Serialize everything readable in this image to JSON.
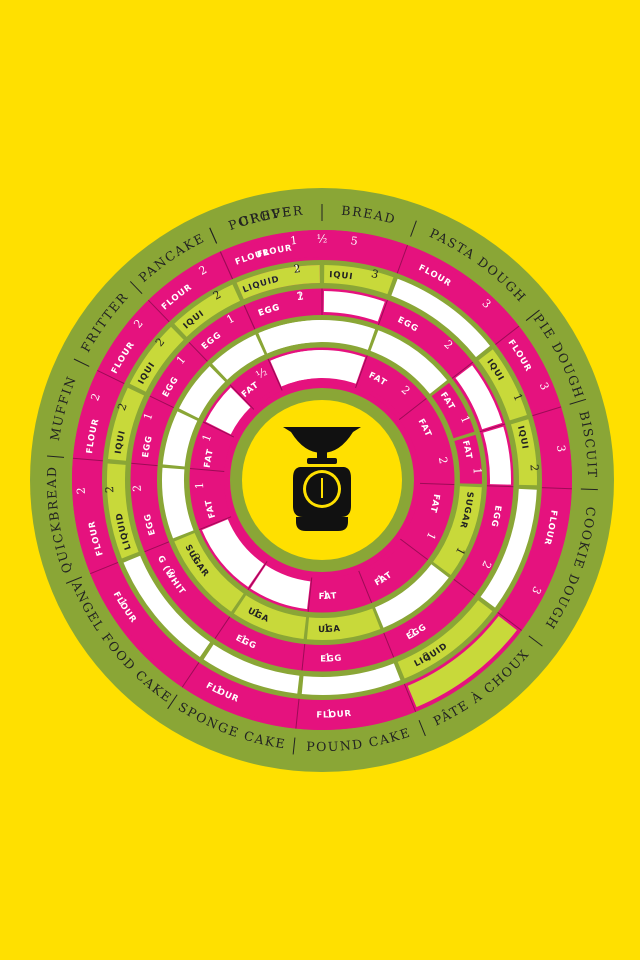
{
  "colors": {
    "background": "#FFE000",
    "olive": "#8AA636",
    "magenta": "#E5127E",
    "lime": "#C8D93A",
    "white": "#FFFFFF",
    "text_dark": "#222222",
    "text_light": "#FFFFFF",
    "scale_icon": "#111111"
  },
  "recipe_order": [
    "Muffin",
    "Fritter",
    "Pancake",
    "Popover",
    "Crepe",
    "Bread",
    "Pasta Dough",
    "Pie Dough",
    "Biscuit",
    "Cookie Dough",
    "Pâte à Choux",
    "Pound Cake",
    "Sponge Cake",
    "Angel Food Cake",
    "Quickbread"
  ],
  "outer_ring": {
    "separator": "|",
    "recipes": [
      {
        "name": "CREPE",
        "start": -24,
        "end": 0
      },
      {
        "name": "BREAD",
        "start": 0,
        "end": 20
      },
      {
        "name": "PASTA DOUGH",
        "start": 20,
        "end": 52
      },
      {
        "name": "PIE DOUGH",
        "start": 52,
        "end": 73
      },
      {
        "name": "BISCUIT",
        "start": 73,
        "end": 92
      },
      {
        "name": "COOKIE DOUGH",
        "start": 92,
        "end": 127
      },
      {
        "name": "PÂTE À CHOUX",
        "start": 127,
        "end": 158
      },
      {
        "name": "POUND CAKE",
        "start": 158,
        "end": 186
      },
      {
        "name": "SPONGE CAKE",
        "start": 186,
        "end": 214
      },
      {
        "name": "ANGEL FOOD CAKE",
        "start": 214,
        "end": 248
      },
      {
        "name": "QUICKBREAD",
        "start": 248,
        "end": 275
      },
      {
        "name": "MUFFIN",
        "start": 275,
        "end": 296
      },
      {
        "name": "FRITTER",
        "start": 296,
        "end": 316
      },
      {
        "name": "PANCAKE",
        "start": 316,
        "end": 336
      },
      {
        "name": "POPOVER",
        "start": 336,
        "end": 360
      }
    ]
  },
  "rings": [
    {
      "name": "ring-1",
      "segments": [
        {
          "ingredient": "FLOUR",
          "qty": "5",
          "start": -24,
          "end": 20,
          "color": "magenta"
        },
        {
          "ingredient": "FLOUR",
          "qty": "3",
          "start": 20,
          "end": 52,
          "color": "magenta"
        },
        {
          "ingredient": "FLOUR",
          "qty": "3",
          "start": 52,
          "end": 73,
          "color": "magenta"
        },
        {
          "ingredient": "",
          "qty": "3",
          "start": 73,
          "end": 92,
          "color": "magenta"
        },
        {
          "ingredient": "FLOUR",
          "qty": "3",
          "start": 92,
          "end": 127,
          "color": "magenta"
        },
        {
          "ingredient": "",
          "qty": "",
          "start": 127,
          "end": 158,
          "color": "lime"
        },
        {
          "ingredient": "FLOUR",
          "qty": "1",
          "start": 158,
          "end": 186,
          "color": "magenta"
        },
        {
          "ingredient": "FLOUR",
          "qty": "1",
          "start": 186,
          "end": 214,
          "color": "magenta"
        },
        {
          "ingredient": "FLOUR",
          "qty": "1",
          "start": 214,
          "end": 248,
          "color": "magenta"
        },
        {
          "ingredient": "FLOUR",
          "qty": "2",
          "start": 248,
          "end": 275,
          "color": "magenta"
        },
        {
          "ingredient": "FLOUR",
          "qty": "2",
          "start": 275,
          "end": 296,
          "color": "magenta"
        },
        {
          "ingredient": "FLOUR",
          "qty": "2",
          "start": 296,
          "end": 316,
          "color": "magenta"
        },
        {
          "ingredient": "FLOUR",
          "qty": "2",
          "start": 316,
          "end": 336,
          "color": "magenta"
        },
        {
          "ingredient": "FLOUR",
          "qty": "1",
          "start": 336,
          "end": 360,
          "color": "magenta"
        },
        {
          "ingredient": "",
          "qty": "½",
          "start": 0,
          "end": 0,
          "color": "none"
        }
      ]
    },
    {
      "name": "ring-2",
      "segments": [
        {
          "ingredient": "LIQUID",
          "qty": "1",
          "start": -24,
          "end": 0,
          "color": "magenta"
        },
        {
          "ingredient": "LIQUID",
          "qty": "3",
          "start": 0,
          "end": 20,
          "color": "lime"
        },
        {
          "ingredient": "",
          "qty": "",
          "start": 20,
          "end": 52,
          "color": "white"
        },
        {
          "ingredient": "LIQUID",
          "qty": "1",
          "start": 52,
          "end": 73,
          "color": "lime"
        },
        {
          "ingredient": "LIQUID",
          "qty": "2",
          "start": 73,
          "end": 92,
          "color": "lime"
        },
        {
          "ingredient": "",
          "qty": "",
          "start": 92,
          "end": 127,
          "color": "white"
        },
        {
          "ingredient": "LIQUID",
          "qty": "2",
          "start": 127,
          "end": 158,
          "color": "lime"
        },
        {
          "ingredient": "",
          "qty": "",
          "start": 158,
          "end": 186,
          "color": "white"
        },
        {
          "ingredient": "",
          "qty": "",
          "start": 186,
          "end": 214,
          "color": "white"
        },
        {
          "ingredient": "",
          "qty": "",
          "start": 214,
          "end": 248,
          "color": "white"
        },
        {
          "ingredient": "LIQUID",
          "qty": "2",
          "start": 248,
          "end": 275,
          "color": "lime"
        },
        {
          "ingredient": "LIQUID",
          "qty": "2",
          "start": 275,
          "end": 296,
          "color": "lime"
        },
        {
          "ingredient": "LIQUID",
          "qty": "2",
          "start": 296,
          "end": 316,
          "color": "lime"
        },
        {
          "ingredient": "LIQUID",
          "qty": "2",
          "start": 316,
          "end": 336,
          "color": "lime"
        },
        {
          "ingredient": "LIQUID",
          "qty": "2",
          "start": 336,
          "end": 360,
          "color": "lime"
        }
      ]
    },
    {
      "name": "ring-3",
      "segments": [
        {
          "ingredient": "EGG",
          "qty": "1",
          "start": -24,
          "end": 0,
          "color": "magenta"
        },
        {
          "ingredient": "",
          "qty": "",
          "start": 0,
          "end": 20,
          "color": "white"
        },
        {
          "ingredient": "EGG",
          "qty": "2",
          "start": 20,
          "end": 52,
          "color": "magenta"
        },
        {
          "ingredient": "",
          "qty": "",
          "start": 52,
          "end": 73,
          "color": "white"
        },
        {
          "ingredient": "",
          "qty": "",
          "start": 73,
          "end": 92,
          "color": "white"
        },
        {
          "ingredient": "EGG",
          "qty": "2",
          "start": 92,
          "end": 127,
          "color": "magenta"
        },
        {
          "ingredient": "EGG",
          "qty": "2",
          "start": 127,
          "end": 158,
          "color": "magenta"
        },
        {
          "ingredient": "EGG",
          "qty": "1",
          "start": 158,
          "end": 186,
          "color": "magenta"
        },
        {
          "ingredient": "EGG",
          "qty": "1",
          "start": 186,
          "end": 214,
          "color": "magenta"
        },
        {
          "ingredient": "EGG (WHITES)",
          "qty": "3",
          "start": 214,
          "end": 248,
          "color": "magenta"
        },
        {
          "ingredient": "EGG",
          "qty": "2",
          "start": 248,
          "end": 275,
          "color": "magenta"
        },
        {
          "ingredient": "EGG",
          "qty": "1",
          "start": 275,
          "end": 296,
          "color": "magenta"
        },
        {
          "ingredient": "EGG",
          "qty": "1",
          "start": 296,
          "end": 316,
          "color": "magenta"
        },
        {
          "ingredient": "EGG",
          "qty": "1",
          "start": 316,
          "end": 336,
          "color": "magenta"
        },
        {
          "ingredient": "EGG",
          "qty": "2",
          "start": 336,
          "end": 360,
          "color": "magenta"
        }
      ]
    },
    {
      "name": "ring-4",
      "segments": [
        {
          "ingredient": "",
          "qty": "",
          "start": -24,
          "end": 20,
          "color": "white"
        },
        {
          "ingredient": "",
          "qty": "",
          "start": 20,
          "end": 52,
          "color": "white"
        },
        {
          "ingredient": "FAT",
          "qty": "1",
          "start": 52,
          "end": 73,
          "color": "magenta"
        },
        {
          "ingredient": "FAT",
          "qty": "1",
          "start": 73,
          "end": 92,
          "color": "magenta"
        },
        {
          "ingredient": "SUGAR",
          "qty": "1",
          "start": 92,
          "end": 127,
          "color": "lime"
        },
        {
          "ingredient": "",
          "qty": "",
          "start": 127,
          "end": 158,
          "color": "white"
        },
        {
          "ingredient": "SUGAR",
          "qty": "1",
          "start": 158,
          "end": 186,
          "color": "lime"
        },
        {
          "ingredient": "SUGAR",
          "qty": "1",
          "start": 186,
          "end": 214,
          "color": "lime"
        },
        {
          "ingredient": "SUGAR",
          "qty": "3",
          "start": 214,
          "end": 248,
          "color": "lime"
        },
        {
          "ingredient": "",
          "qty": "",
          "start": 248,
          "end": 275,
          "color": "white"
        },
        {
          "ingredient": "",
          "qty": "",
          "start": 275,
          "end": 296,
          "color": "white"
        },
        {
          "ingredient": "",
          "qty": "",
          "start": 296,
          "end": 316,
          "color": "white"
        },
        {
          "ingredient": "",
          "qty": "",
          "start": 316,
          "end": 336,
          "color": "white"
        },
        {
          "ingredient": "",
          "qty": "",
          "start": 336,
          "end": 360,
          "color": "white"
        }
      ]
    },
    {
      "name": "ring-5",
      "segments": [
        {
          "ingredient": "",
          "qty": "",
          "start": -24,
          "end": 20,
          "color": "white"
        },
        {
          "ingredient": "FAT",
          "qty": "2",
          "start": 20,
          "end": 52,
          "color": "magenta"
        },
        {
          "ingredient": "FAT",
          "qty": "2",
          "start": 52,
          "end": 92,
          "color": "magenta"
        },
        {
          "ingredient": "FAT",
          "qty": "1",
          "start": 92,
          "end": 127,
          "color": "magenta"
        },
        {
          "ingredient": "FAT",
          "qty": "1",
          "start": 127,
          "end": 158,
          "color": "magenta"
        },
        {
          "ingredient": "FAT",
          "qty": "1",
          "start": 158,
          "end": 186,
          "color": "magenta"
        },
        {
          "ingredient": "",
          "qty": "",
          "start": 186,
          "end": 214,
          "color": "white"
        },
        {
          "ingredient": "",
          "qty": "",
          "start": 214,
          "end": 248,
          "color": "white"
        },
        {
          "ingredient": "FAT",
          "qty": "1",
          "start": 248,
          "end": 275,
          "color": "magenta"
        },
        {
          "ingredient": "FAT",
          "qty": "1",
          "start": 275,
          "end": 296,
          "color": "magenta"
        },
        {
          "ingredient": "",
          "qty": "",
          "start": 296,
          "end": 316,
          "color": "white"
        },
        {
          "ingredient": "FAT",
          "qty": "½",
          "start": 316,
          "end": 336,
          "color": "magenta"
        },
        {
          "ingredient": "",
          "qty": "",
          "start": 336,
          "end": 360,
          "color": "white"
        }
      ]
    }
  ],
  "center_icon": "kitchen-scale-icon"
}
